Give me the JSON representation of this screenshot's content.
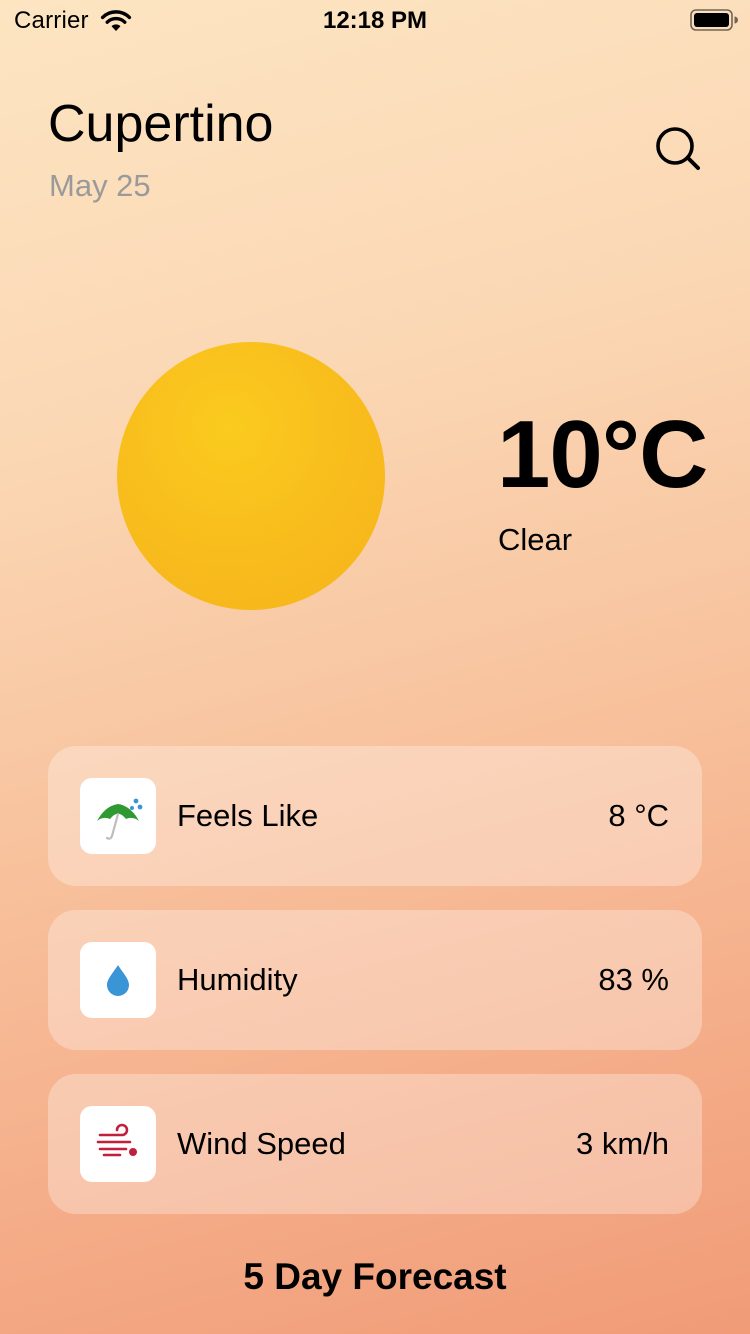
{
  "status_bar": {
    "carrier": "Carrier",
    "time": "12:18 PM",
    "wifi_icon": "wifi-icon",
    "battery_icon": "battery-icon"
  },
  "header": {
    "city": "Cupertino",
    "date": "May 25",
    "search_icon": "search-icon"
  },
  "current": {
    "temperature": "10°C",
    "condition": "Clear",
    "condition_icon": "sun-icon",
    "sun_color": "#f8bc1c"
  },
  "stats": [
    {
      "label": "Feels Like",
      "value": "8 °C",
      "icon": "umbrella-icon",
      "icon_color": "#2e8b2e"
    },
    {
      "label": "Humidity",
      "value": "83 %",
      "icon": "water-drop-icon",
      "icon_color": "#3a95d6"
    },
    {
      "label": "Wind Speed",
      "value": "3 km/h",
      "icon": "wind-icon",
      "icon_color": "#c21f3c"
    }
  ],
  "forecast": {
    "title": "5 Day Forecast"
  }
}
